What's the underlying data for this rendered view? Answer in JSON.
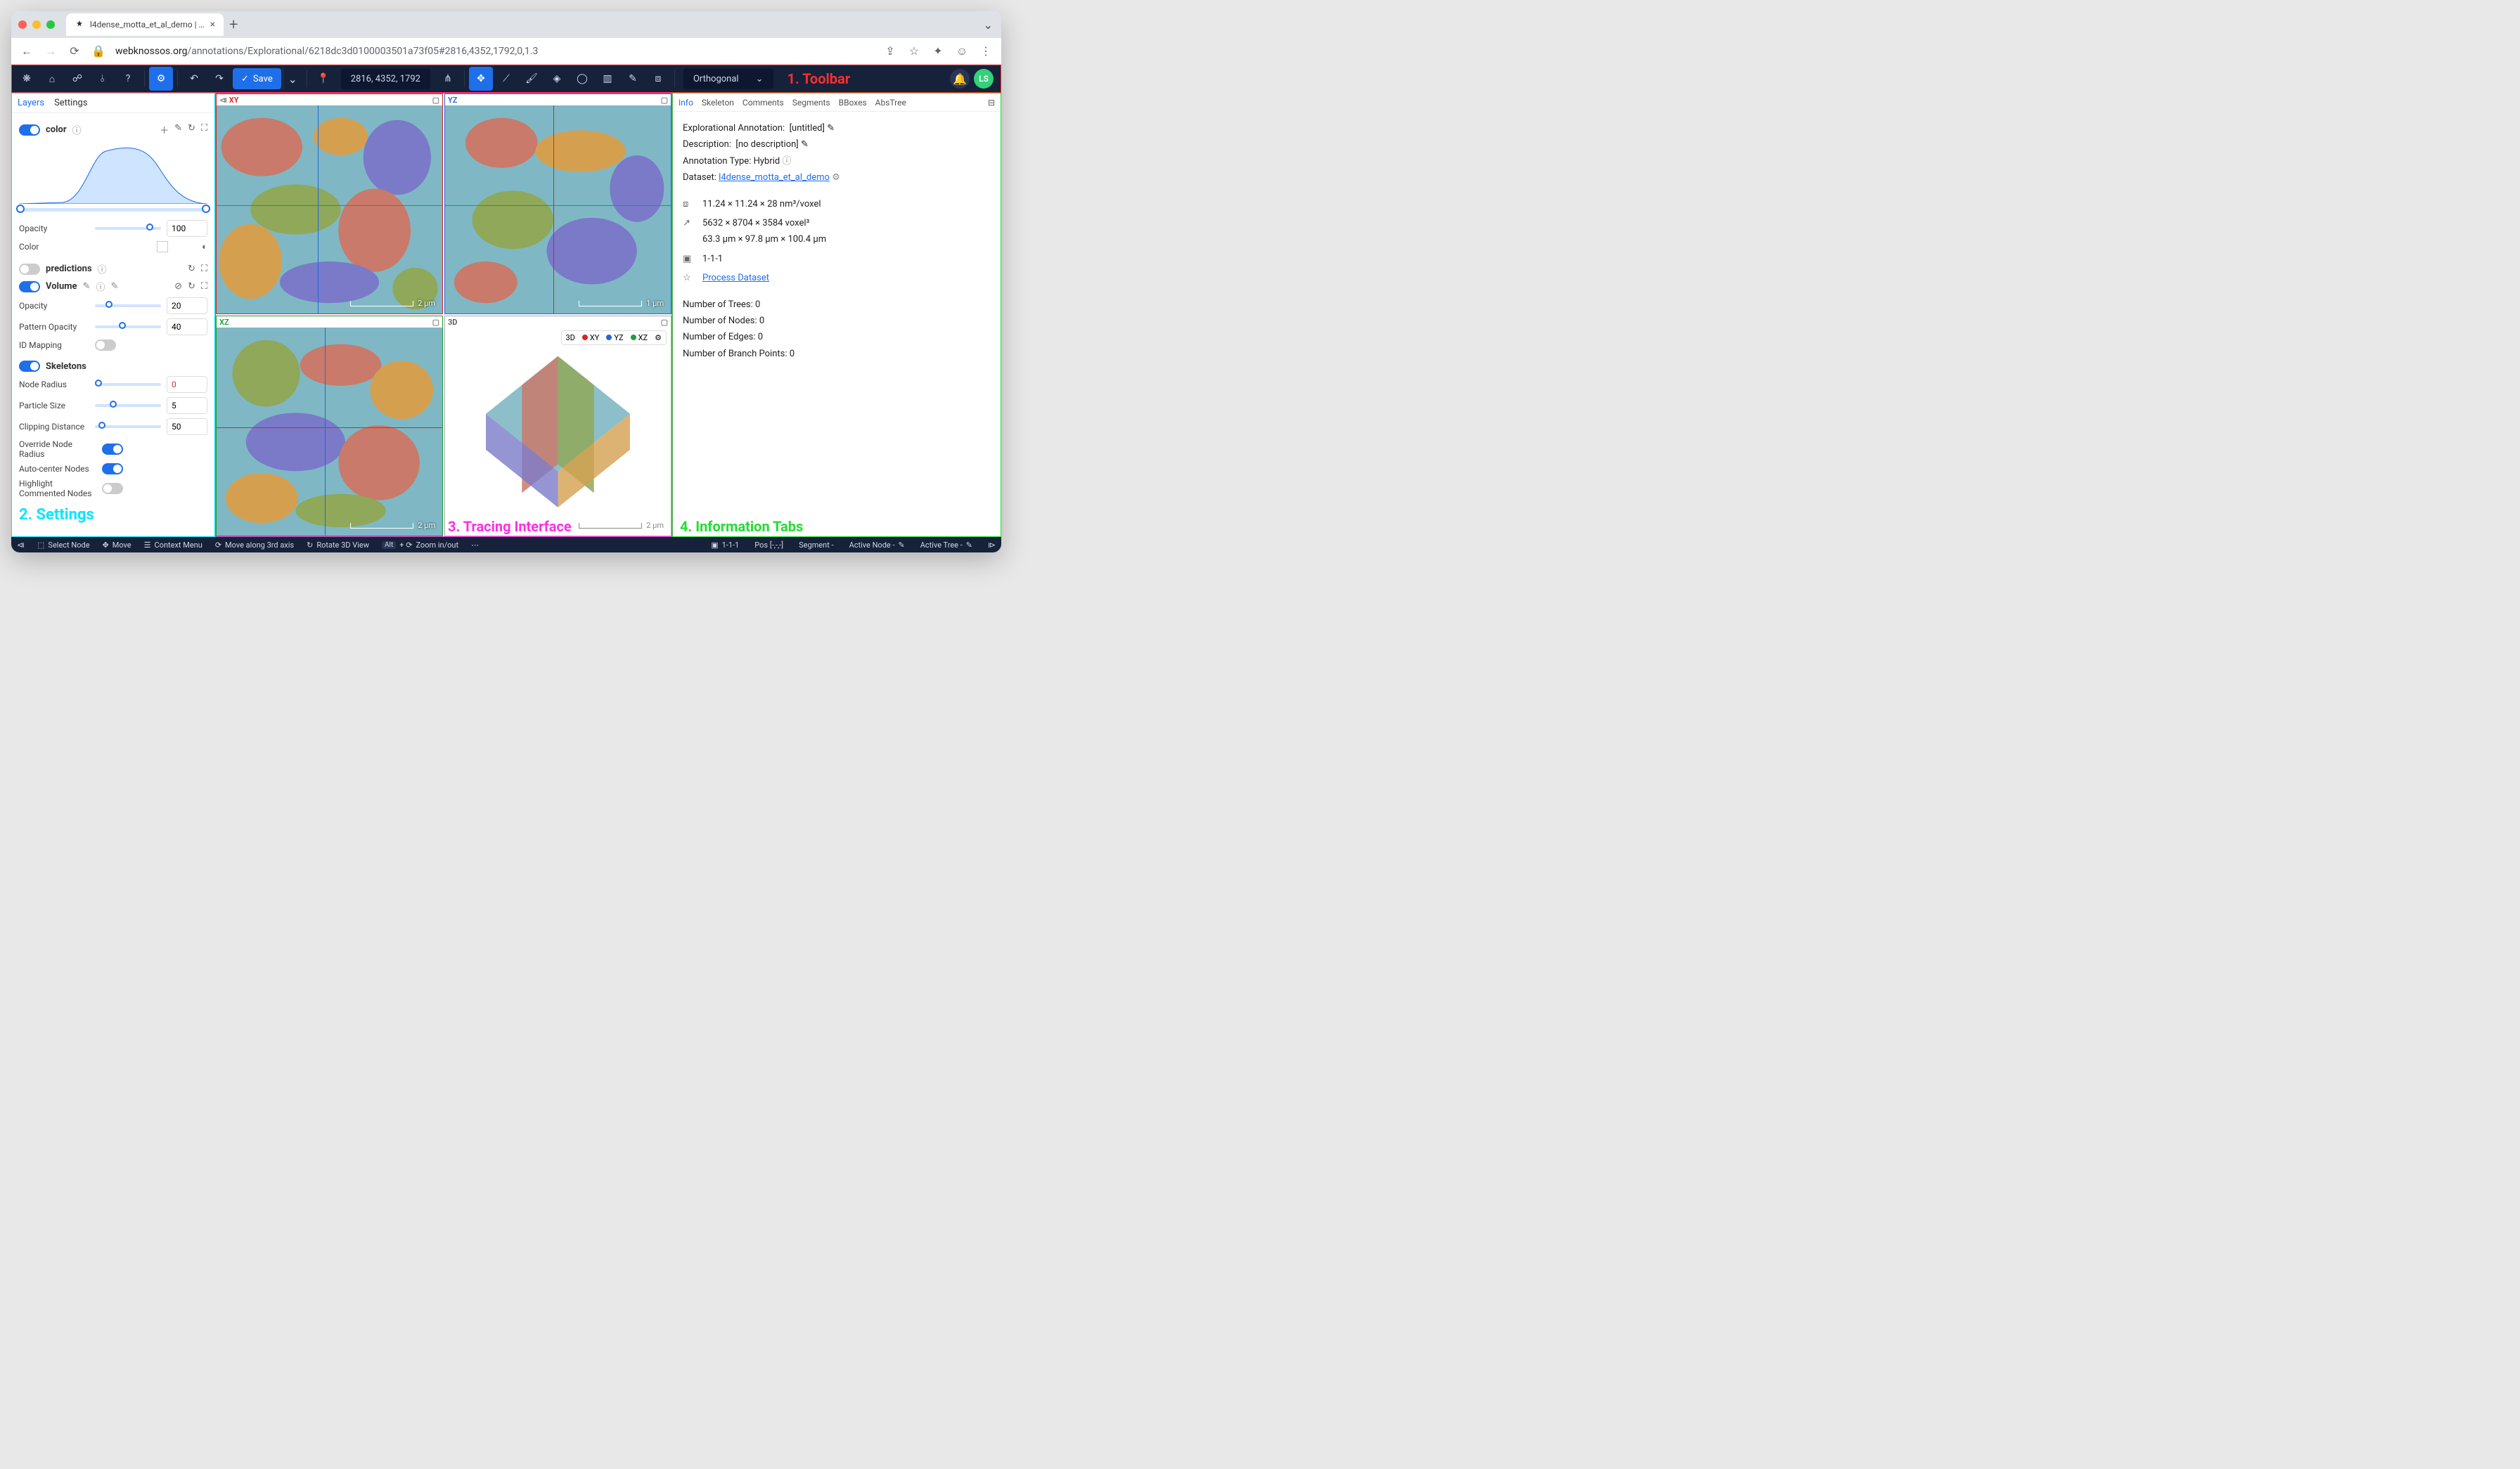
{
  "browser": {
    "tab_title": "l4dense_motta_et_al_demo | …",
    "url_host": "webknossos.org",
    "url_path": "/annotations/Explorational/6218dc3d0100003501a73f05#2816,4352,1792,0,1.3"
  },
  "toolbar": {
    "save_label": "Save",
    "coords": "2816, 4352, 1792",
    "viewmode": "Orthogonal",
    "annotation_label": "1. Toolbar",
    "avatar_initials": "LS"
  },
  "sidebar": {
    "tabs": [
      "Layers",
      "Settings"
    ],
    "active_tab": "Layers",
    "color_layer": {
      "name": "color",
      "opacity_label": "Opacity",
      "opacity_value": "100",
      "color_label": "Color"
    },
    "predictions_layer": {
      "name": "predictions"
    },
    "volume_layer": {
      "name": "Volume",
      "opacity_label": "Opacity",
      "opacity_value": "20",
      "pattern_label": "Pattern Opacity",
      "pattern_value": "40",
      "idmapping_label": "ID Mapping"
    },
    "skeletons": {
      "title": "Skeletons",
      "node_radius_label": "Node Radius",
      "node_radius_value": "0",
      "particle_label": "Particle Size",
      "particle_value": "5",
      "clipping_label": "Clipping Distance",
      "clipping_value": "50",
      "override_label": "Override Node Radius",
      "autocenter_label": "Auto-center Nodes",
      "highlight_label": "Highlight Commented Nodes"
    },
    "annotation_label": "2. Settings"
  },
  "viewports": {
    "xy": {
      "label": "XY",
      "scale": "2 µm"
    },
    "yz": {
      "label": "YZ",
      "scale": "1 µm"
    },
    "xz": {
      "label": "XZ",
      "scale": "2 µm"
    },
    "three_d": {
      "label": "3D",
      "scale": "2 µm",
      "legend": {
        "btn3d": "3D",
        "xy": "XY",
        "yz": "YZ",
        "xz": "XZ"
      }
    },
    "annotation_label": "3. Tracing Interface"
  },
  "info_panel": {
    "tabs": [
      "Info",
      "Skeleton",
      "Comments",
      "Segments",
      "BBoxes",
      "AbsTree"
    ],
    "active_tab": "Info",
    "annotation_label_key": "Explorational Annotation:",
    "annotation_label_val": "[untitled]",
    "description_key": "Description:",
    "description_val": "[no description]",
    "type_key": "Annotation Type:",
    "type_val": "Hybrid",
    "dataset_key": "Dataset:",
    "dataset_link": "l4dense_motta_et_al_demo",
    "voxel_size": "11.24 × 11.24 × 28 nm³/voxel",
    "extent_voxel": "5632 × 8704 × 3584 voxel³",
    "extent_um": "63.3 µm × 97.8 µm × 100.4 µm",
    "mag": "1-1-1",
    "process_link": "Process Dataset",
    "trees": "Number of Trees: 0",
    "nodes": "Number of Nodes: 0",
    "edges": "Number of Edges: 0",
    "branch": "Number of Branch Points: 0",
    "annotation_label": "4. Information Tabs"
  },
  "statusbar": {
    "select": "Select Node",
    "move": "Move",
    "context": "Context Menu",
    "axis3": "Move along 3rd axis",
    "rotate": "Rotate 3D View",
    "zoom_key": "Alt",
    "zoom_plus": "+",
    "zoom_scroll_icon": "⟳",
    "zoom": "Zoom in/out",
    "mag": "1-1-1",
    "pos": "Pos [-,-,-]",
    "segment": "Segment -",
    "active_node": "Active Node -",
    "active_tree": "Active Tree -"
  }
}
